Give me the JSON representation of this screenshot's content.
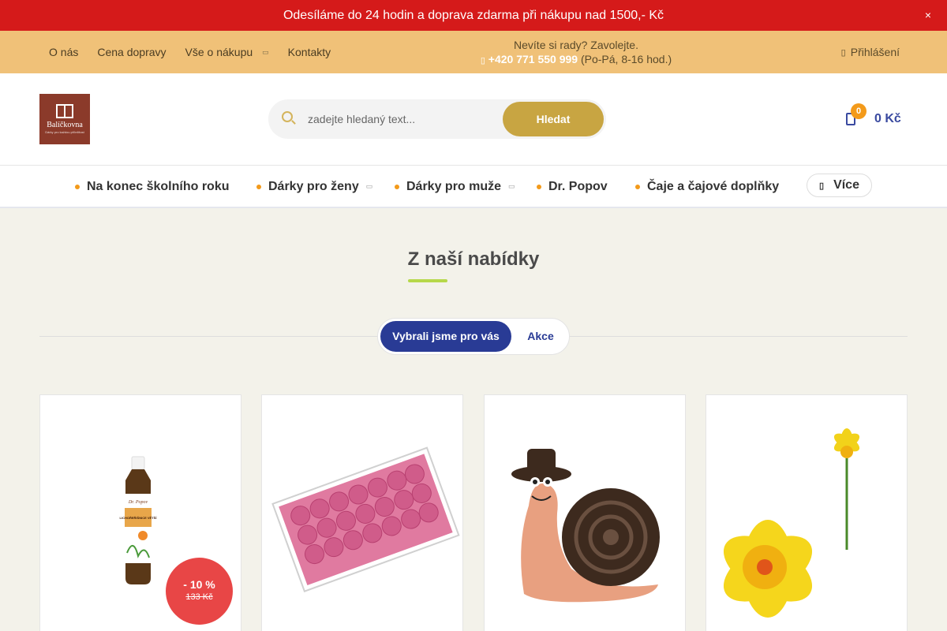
{
  "topbar": {
    "message": "Odesíláme do 24 hodin a doprava zdarma při nákupu nad 1500,- Kč",
    "close_glyph": "×"
  },
  "infobar": {
    "links": [
      {
        "label": "O nás"
      },
      {
        "label": "Cena dopravy"
      },
      {
        "label": "Vše o nákupu",
        "has_dropdown": true
      },
      {
        "label": "Kontakty"
      }
    ],
    "contact_prompt": "Nevíte si rady? Zavolejte.",
    "phone": "+420 771 550 999",
    "hours": "(Po-Pá, 8-16 hod.)",
    "login_label": "Přihlášení"
  },
  "header": {
    "logo_text": "Balíčkovna",
    "logo_tagline": "Dárky pro každou příležitost",
    "search": {
      "placeholder": "zadejte hledaný text...",
      "button_label": "Hledat"
    },
    "cart": {
      "count": "0",
      "total": "0 Kč"
    }
  },
  "menu": {
    "items": [
      {
        "label": "Na konec školního roku"
      },
      {
        "label": "Dárky pro ženy",
        "has_dropdown": true
      },
      {
        "label": "Dárky pro muže",
        "has_dropdown": true
      },
      {
        "label": "Dr. Popov"
      },
      {
        "label": "Čaje a čajové doplňky"
      }
    ],
    "more_label": "Více"
  },
  "section": {
    "title": "Z naší nabídky",
    "tabs": [
      {
        "label": "Vybrali jsme pro vás",
        "active": true
      },
      {
        "label": "Akce",
        "active": false
      }
    ]
  },
  "products": [
    {
      "image": "dr-popov-herbal-drops-bottle",
      "bottle_brand": "Dr. Popov",
      "bottle_label": "LICHOŘEŘIŠNICE VĚTŠÍ",
      "discount": "- 10 %",
      "old_price": "133 Kč"
    },
    {
      "image": "pink-soap-roses-box"
    },
    {
      "image": "ceramic-snail-figurine"
    },
    {
      "image": "yellow-daffodil-flower"
    }
  ],
  "colors": {
    "topbar": "#d51a1a",
    "infobar": "#f0c178",
    "accent_gold": "#c8a542",
    "navy": "#293b95",
    "orange": "#f39a1a",
    "sale_red": "#e84646",
    "underline_green": "#b6d84a"
  }
}
